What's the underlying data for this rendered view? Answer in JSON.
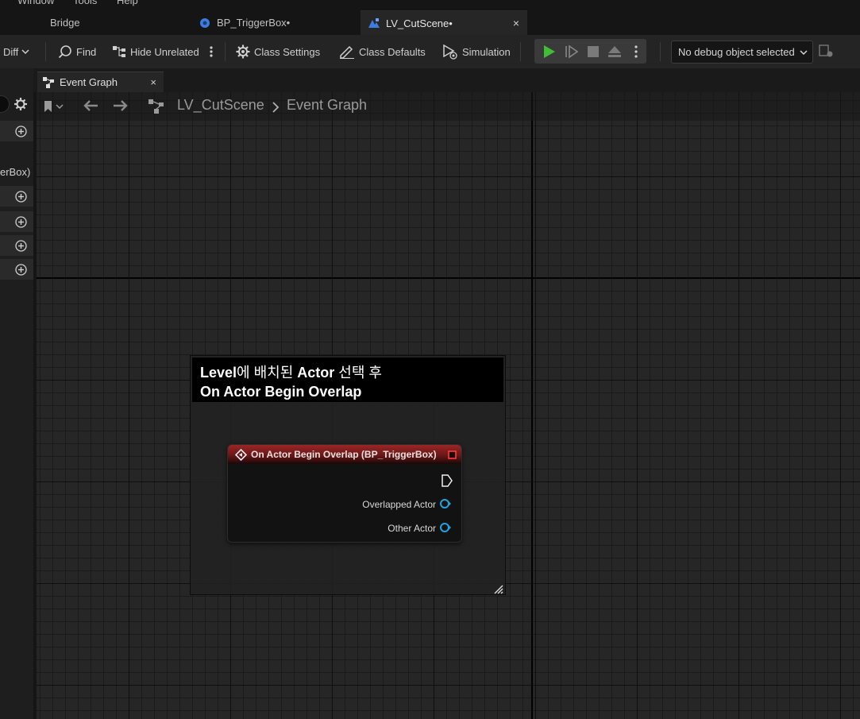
{
  "menubar": {
    "items": [
      "Window",
      "Tools",
      "Help"
    ]
  },
  "tabs": [
    {
      "label": "Bridge",
      "active": false
    },
    {
      "label": "BP_TriggerBox•",
      "active": false
    },
    {
      "label": "LV_CutScene•",
      "active": true,
      "close": "×"
    }
  ],
  "toolbar": {
    "diff_label": "Diff",
    "find_label": "Find",
    "hide_unrelated_label": "Hide Unrelated",
    "class_settings_label": "Class Settings",
    "class_defaults_label": "Class Defaults",
    "simulation_label": "Simulation",
    "debug_object_label": "No debug object selected"
  },
  "left_panel": {
    "partial_label": "erBox)"
  },
  "graph_tab": {
    "label": "Event Graph",
    "close": "×"
  },
  "breadcrumb": {
    "level": "LV_CutScene",
    "graph": "Event Graph"
  },
  "comment": {
    "line1_a": "Level",
    "line1_b": "에 배치된 ",
    "line1_c": "Actor",
    "line1_d": " 선택 후",
    "line2": "On Actor Begin Overlap"
  },
  "node": {
    "title": "On Actor Begin Overlap (BP_TriggerBox)",
    "pins": [
      "Overlapped Actor",
      "Other Actor"
    ]
  },
  "colors": {
    "accent_play": "#3fbe36",
    "event_header": "#8c2020",
    "object_pin": "#1fa4e0",
    "tab_icon_blue": "#3d7de0"
  }
}
